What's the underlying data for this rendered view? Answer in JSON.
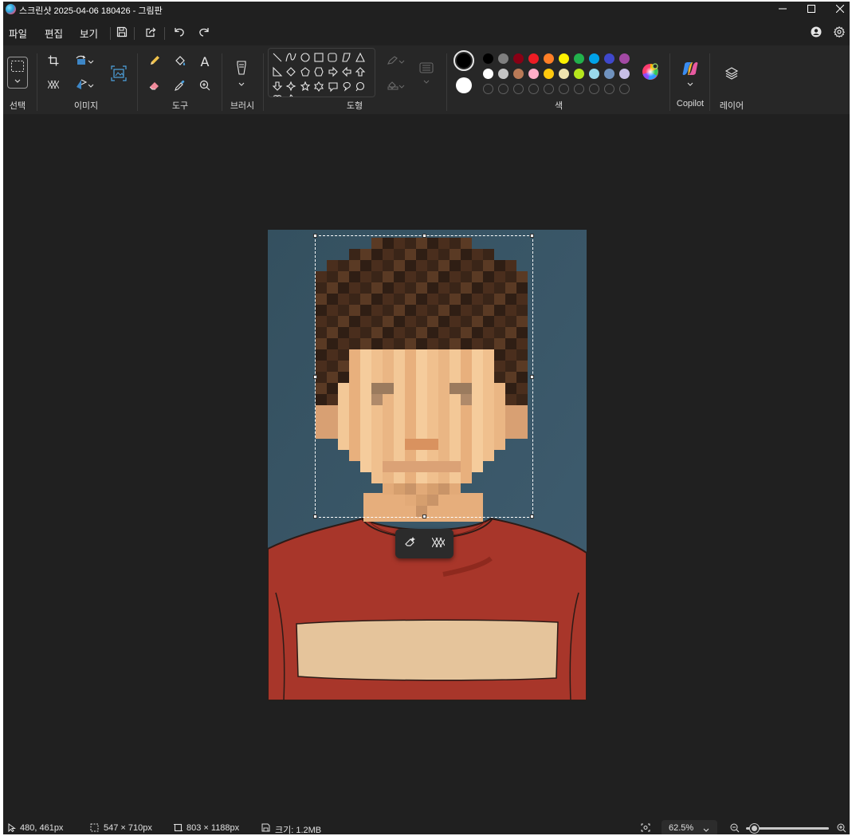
{
  "window": {
    "title": "스크린샷 2025-04-06 180426 - 그림판",
    "app_icon": "paint-app-icon",
    "controls": [
      "minimize-icon",
      "maximize-icon",
      "close-icon"
    ]
  },
  "menu": {
    "items": [
      "파일",
      "편집",
      "보기"
    ],
    "icons": [
      "save-icon",
      "share-icon",
      "undo-icon",
      "redo-icon",
      "account-icon",
      "settings-icon"
    ]
  },
  "ribbon": {
    "groups": {
      "select": "선택",
      "image": "이미지",
      "tools": "도구",
      "brush": "브러시",
      "shapes": "도형",
      "colors": "색",
      "copilot": "Copilot",
      "layers": "레이어"
    },
    "tools": {
      "text_tool": "A"
    },
    "palette": {
      "primary": "#000000",
      "secondary": "#ffffff",
      "row1": [
        "#000000",
        "#7f7f7f",
        "#880015",
        "#ed1c24",
        "#ff7f27",
        "#fff200",
        "#22b14c",
        "#00a2e8",
        "#3f48cc",
        "#a349a4"
      ],
      "row2": [
        "#ffffff",
        "#c3c3c3",
        "#b97a57",
        "#ffaec9",
        "#ffc90e",
        "#efe4b0",
        "#b5e61d",
        "#99d9ea",
        "#7092be",
        "#c8bfe7"
      ],
      "row3_empty_count": 10
    }
  },
  "status": {
    "cursor_position": "480, 461px",
    "selection_size": "547 × 710px",
    "canvas_size": "803 × 1188px",
    "file_size": "크기: 1.2MB",
    "zoom": "62.5%",
    "zoom_slider_level": 0.1
  }
}
